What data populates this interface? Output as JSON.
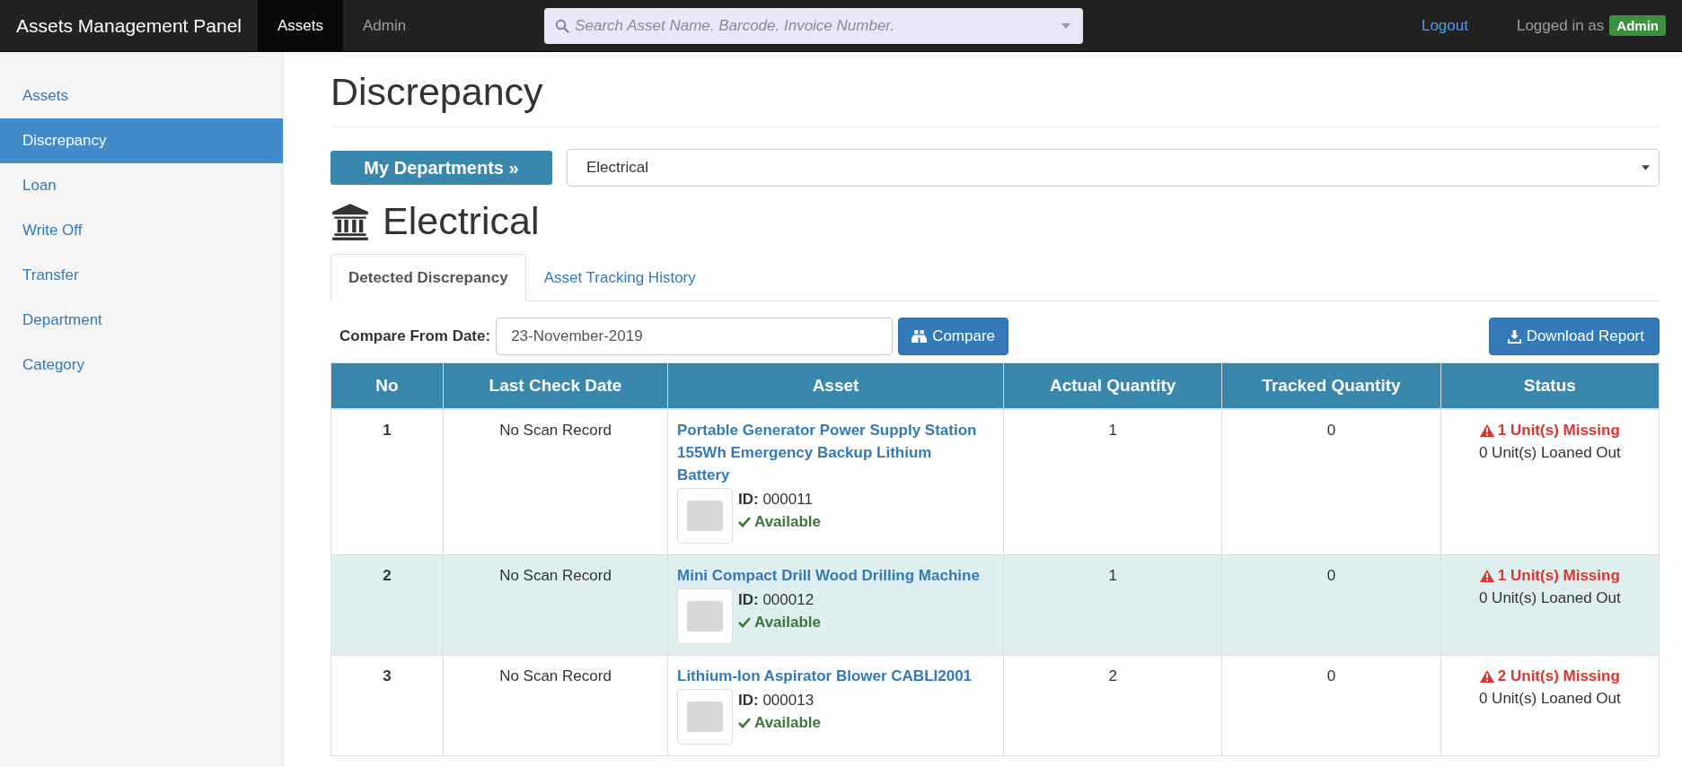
{
  "navbar": {
    "brand": "Assets Management Panel",
    "tabs": [
      {
        "label": "Assets",
        "selected": true
      },
      {
        "label": "Admin",
        "selected": false
      }
    ],
    "search": {
      "placeholder": "Search Asset Name. Barcode. Invoice Number."
    },
    "logout": "Logout",
    "logged_in_label": "Logged in as",
    "user_badge": "Admin"
  },
  "sidebar": {
    "items": [
      {
        "label": "Assets",
        "selected": false
      },
      {
        "label": "Discrepancy",
        "selected": true
      },
      {
        "label": "Loan",
        "selected": false
      },
      {
        "label": "Write Off",
        "selected": false
      },
      {
        "label": "Transfer",
        "selected": false
      },
      {
        "label": "Department",
        "selected": false
      },
      {
        "label": "Category",
        "selected": false
      }
    ]
  },
  "page": {
    "title": "Discrepancy",
    "department_button": "My Departments »",
    "department_select": {
      "value": "Electrical"
    },
    "department_heading": "Electrical",
    "tabs": [
      {
        "label": "Detected Discrepancy",
        "selected": true
      },
      {
        "label": "Asset Tracking History",
        "selected": false
      }
    ],
    "compare_label": "Compare From Date:",
    "compare_date": {
      "value": "23-November-2019"
    },
    "compare_button": "Compare",
    "download_button": "Download Report"
  },
  "table": {
    "columns": [
      "No",
      "Last Check Date",
      "Asset",
      "Actual Quantity",
      "Tracked Quantity",
      "Status"
    ],
    "rows": [
      {
        "no": "1",
        "last_check": "No Scan Record",
        "asset": "Portable Generator Power Supply Station 155Wh Emergency Backup Lithium Battery",
        "id": "**ID:** 000011",
        "available": true,
        "availability": "Available",
        "actual": "1",
        "tracked": "0",
        "missing": "1 Unit(s) Missing",
        "loaned": "0 Unit(s) Loaned Out"
      },
      {
        "no": "2",
        "last_check": "No Scan Record",
        "asset": "Mini Compact Drill Wood Drilling Machine",
        "id": "**ID:** 000012",
        "available": true,
        "availability": "Available",
        "actual": "1",
        "tracked": "0",
        "missing": "1 Unit(s) Missing",
        "loaned": "0 Unit(s) Loaned Out"
      },
      {
        "no": "3",
        "last_check": "No Scan Record",
        "asset": "Lithium-Ion Aspirator Blower CABLI2001",
        "id": "**ID:** 000013",
        "available": true,
        "availability": "Available",
        "actual": "2",
        "tracked": "0",
        "missing": "2 Unit(s) Missing",
        "loaned": "0 Unit(s) Loaned Out"
      }
    ]
  }
}
